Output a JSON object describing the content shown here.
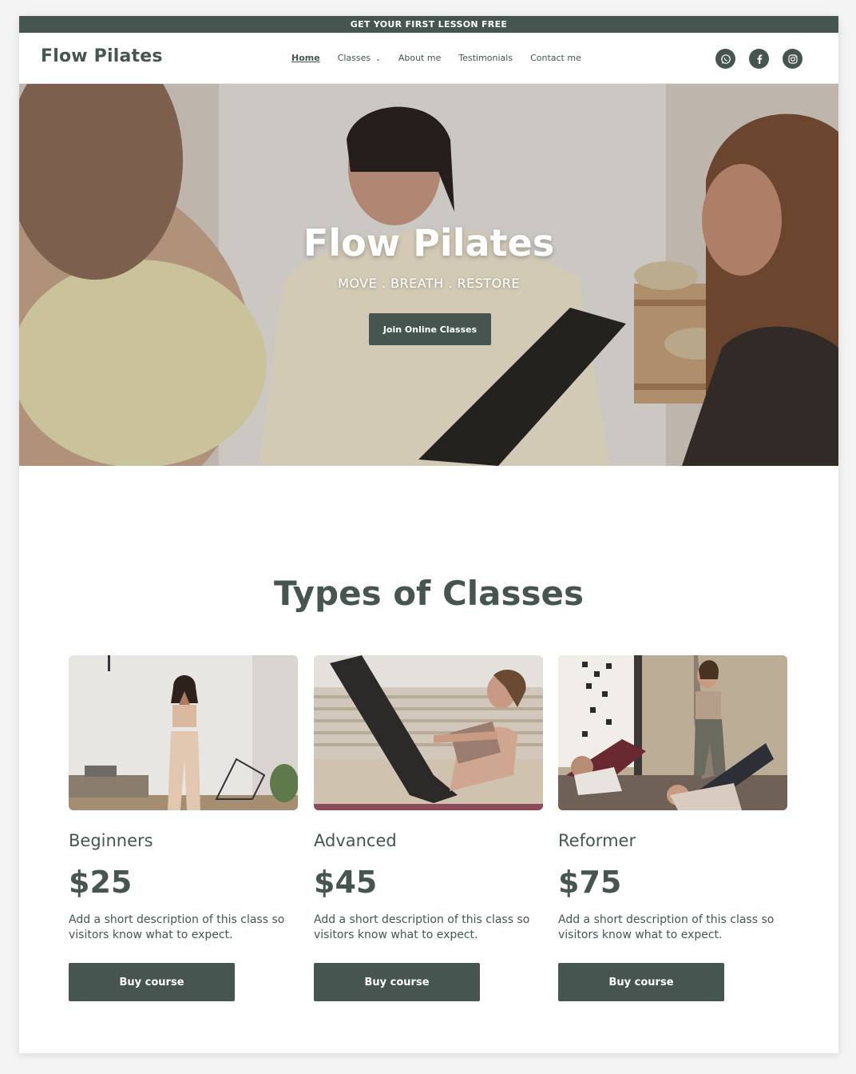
{
  "promo": {
    "text": "GET YOUR FIRST LESSON FREE"
  },
  "header": {
    "logo": "Flow Pilates",
    "nav": [
      {
        "label": "Home"
      },
      {
        "label": "Classes"
      },
      {
        "label": "About me"
      },
      {
        "label": "Testimonials"
      },
      {
        "label": "Contact me"
      }
    ],
    "socials": [
      {
        "icon": "whatsapp-icon"
      },
      {
        "icon": "facebook-icon"
      },
      {
        "icon": "instagram-icon"
      }
    ]
  },
  "hero": {
    "title": "Flow Pilates",
    "tagline": "MOVE . BREATH . RESTORE",
    "cta": "Join Online Classes"
  },
  "classes": {
    "heading": "Types of Classes",
    "items": [
      {
        "name": "Beginners",
        "price": "$25",
        "description": "Add a short description of this class so visitors know what to expect.",
        "button": "Buy course"
      },
      {
        "name": "Advanced",
        "price": "$45",
        "description": "Add a short description of this class so visitors know what to expect.",
        "button": "Buy course"
      },
      {
        "name": "Reformer",
        "price": "$75",
        "description": "Add a short description of this class so visitors know what to expect.",
        "button": "Buy course"
      }
    ]
  },
  "colors": {
    "brand": "#46554f",
    "background": "#ffffff"
  }
}
